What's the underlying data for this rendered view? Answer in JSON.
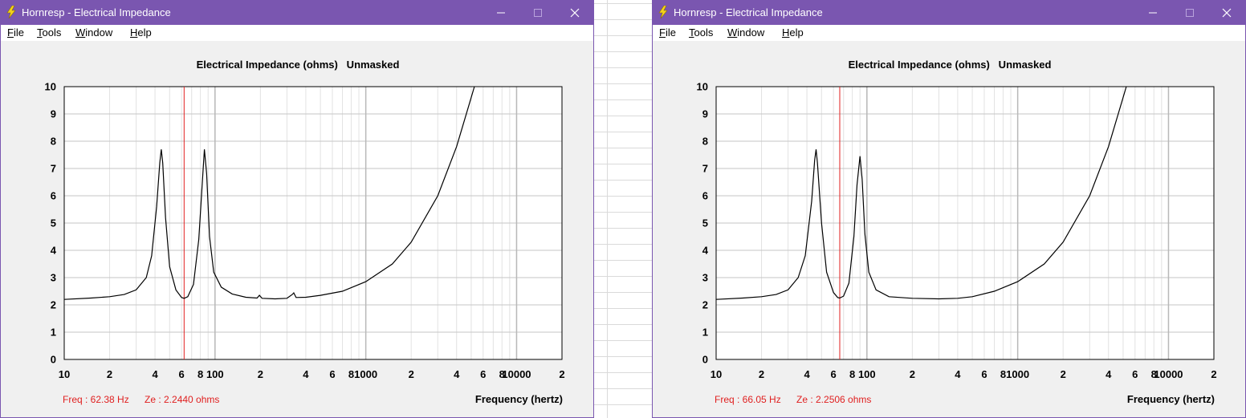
{
  "background": {
    "grid_color": "#dadada"
  },
  "windows": [
    {
      "title": "Hornresp - Electrical Impedance",
      "menu": [
        "File",
        "Tools",
        "Window",
        "Help"
      ],
      "controls": {
        "minimize_icon": "minimize-icon",
        "maximize_icon": "maximize-icon",
        "close_icon": "close-icon"
      },
      "readout": {
        "freq": "Freq : 62.38 Hz",
        "ze": "Ze : 2.2440 ohms"
      },
      "chart_data": {
        "type": "line",
        "title": "Electrical Impedance (ohms)   Unmasked",
        "xlabel": "Frequency (hertz)",
        "ylabel": "",
        "xscale": "log",
        "xlim": [
          10,
          20000
        ],
        "ylim": [
          0,
          10
        ],
        "grid": true,
        "yticks": [
          "0",
          "1",
          "2",
          "3",
          "4",
          "5",
          "6",
          "7",
          "8",
          "9",
          "10"
        ],
        "xticks": [
          {
            "v": 10,
            "t": "10"
          },
          {
            "v": 20,
            "t": "2"
          },
          {
            "v": 40,
            "t": "4"
          },
          {
            "v": 60,
            "t": "6"
          },
          {
            "v": 80,
            "t": "8"
          },
          {
            "v": 100,
            "t": "100"
          },
          {
            "v": 200,
            "t": "2"
          },
          {
            "v": 400,
            "t": "4"
          },
          {
            "v": 600,
            "t": "6"
          },
          {
            "v": 800,
            "t": "8"
          },
          {
            "v": 1000,
            "t": "1000"
          },
          {
            "v": 2000,
            "t": "2"
          },
          {
            "v": 4000,
            "t": "4"
          },
          {
            "v": 6000,
            "t": "6"
          },
          {
            "v": 8000,
            "t": "8"
          },
          {
            "v": 10000,
            "t": "10000"
          },
          {
            "v": 20000,
            "t": "2"
          }
        ],
        "marker_x": 62.38,
        "series": [
          {
            "values": [
              [
                10,
                2.2
              ],
              [
                15,
                2.25
              ],
              [
                20,
                2.3
              ],
              [
                25,
                2.38
              ],
              [
                30,
                2.55
              ],
              [
                35,
                3.0
              ],
              [
                38,
                3.8
              ],
              [
                41,
                5.6
              ],
              [
                43,
                7.2
              ],
              [
                44,
                7.7
              ],
              [
                45,
                7.2
              ],
              [
                47,
                5.2
              ],
              [
                50,
                3.4
              ],
              [
                55,
                2.55
              ],
              [
                60,
                2.27
              ],
              [
                62.4,
                2.24
              ],
              [
                66,
                2.3
              ],
              [
                72,
                2.75
              ],
              [
                78,
                4.4
              ],
              [
                82,
                6.3
              ],
              [
                85,
                7.7
              ],
              [
                88,
                6.8
              ],
              [
                92,
                4.5
              ],
              [
                98,
                3.2
              ],
              [
                110,
                2.65
              ],
              [
                130,
                2.4
              ],
              [
                160,
                2.28
              ],
              [
                190,
                2.25
              ],
              [
                197,
                2.35
              ],
              [
                205,
                2.24
              ],
              [
                250,
                2.22
              ],
              [
                300,
                2.24
              ],
              [
                325,
                2.38
              ],
              [
                333,
                2.44
              ],
              [
                345,
                2.27
              ],
              [
                400,
                2.28
              ],
              [
                500,
                2.35
              ],
              [
                700,
                2.5
              ],
              [
                1000,
                2.85
              ],
              [
                1500,
                3.5
              ],
              [
                2000,
                4.3
              ],
              [
                3000,
                6.0
              ],
              [
                4000,
                7.8
              ],
              [
                5000,
                9.6
              ],
              [
                5250,
                10
              ]
            ]
          }
        ]
      }
    },
    {
      "title": "Hornresp - Electrical Impedance",
      "menu": [
        "File",
        "Tools",
        "Window",
        "Help"
      ],
      "controls": {
        "minimize_icon": "minimize-icon",
        "maximize_icon": "maximize-icon",
        "close_icon": "close-icon"
      },
      "readout": {
        "freq": "Freq : 66.05 Hz",
        "ze": "Ze : 2.2506 ohms"
      },
      "chart_data": {
        "type": "line",
        "title": "Electrical Impedance (ohms)   Unmasked",
        "xlabel": "Frequency (hertz)",
        "ylabel": "",
        "xscale": "log",
        "xlim": [
          10,
          20000
        ],
        "ylim": [
          0,
          10
        ],
        "grid": true,
        "yticks": [
          "0",
          "1",
          "2",
          "3",
          "4",
          "5",
          "6",
          "7",
          "8",
          "9",
          "10"
        ],
        "xticks": [
          {
            "v": 10,
            "t": "10"
          },
          {
            "v": 20,
            "t": "2"
          },
          {
            "v": 40,
            "t": "4"
          },
          {
            "v": 60,
            "t": "6"
          },
          {
            "v": 80,
            "t": "8"
          },
          {
            "v": 100,
            "t": "100"
          },
          {
            "v": 200,
            "t": "2"
          },
          {
            "v": 400,
            "t": "4"
          },
          {
            "v": 600,
            "t": "6"
          },
          {
            "v": 800,
            "t": "8"
          },
          {
            "v": 1000,
            "t": "1000"
          },
          {
            "v": 2000,
            "t": "2"
          },
          {
            "v": 4000,
            "t": "4"
          },
          {
            "v": 6000,
            "t": "6"
          },
          {
            "v": 8000,
            "t": "8"
          },
          {
            "v": 10000,
            "t": "10000"
          },
          {
            "v": 20000,
            "t": "2"
          }
        ],
        "marker_x": 66.05,
        "series": [
          {
            "values": [
              [
                10,
                2.2
              ],
              [
                15,
                2.25
              ],
              [
                20,
                2.3
              ],
              [
                25,
                2.38
              ],
              [
                30,
                2.55
              ],
              [
                35,
                3.0
              ],
              [
                39,
                3.8
              ],
              [
                43,
                5.8
              ],
              [
                45,
                7.3
              ],
              [
                46,
                7.7
              ],
              [
                47,
                7.2
              ],
              [
                50,
                5.0
              ],
              [
                54,
                3.2
              ],
              [
                60,
                2.45
              ],
              [
                64,
                2.27
              ],
              [
                66,
                2.25
              ],
              [
                70,
                2.32
              ],
              [
                76,
                2.8
              ],
              [
                82,
                4.5
              ],
              [
                86,
                6.4
              ],
              [
                90,
                7.45
              ],
              [
                93,
                6.6
              ],
              [
                97,
                4.6
              ],
              [
                103,
                3.2
              ],
              [
                115,
                2.55
              ],
              [
                140,
                2.3
              ],
              [
                200,
                2.24
              ],
              [
                300,
                2.22
              ],
              [
                400,
                2.24
              ],
              [
                500,
                2.3
              ],
              [
                700,
                2.5
              ],
              [
                1000,
                2.85
              ],
              [
                1500,
                3.5
              ],
              [
                2000,
                4.3
              ],
              [
                3000,
                6.0
              ],
              [
                4000,
                7.8
              ],
              [
                5000,
                9.6
              ],
              [
                5250,
                10
              ]
            ]
          }
        ]
      }
    }
  ]
}
